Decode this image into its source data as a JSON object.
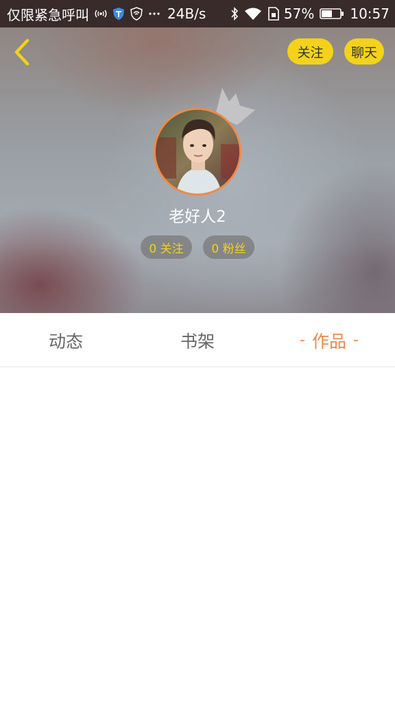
{
  "status_bar": {
    "carrier": "仅限紧急呼叫",
    "speed": "24B/s",
    "battery": "57%",
    "time": "10:57",
    "icons": [
      "signal-icon",
      "shield-icon",
      "vpn-icon",
      "more-icon",
      "bluetooth-icon",
      "wifi-icon",
      "sim-icon",
      "battery-icon"
    ]
  },
  "header": {
    "back_icon": "chevron-left-icon",
    "follow_label": "关注",
    "chat_label": "聊天",
    "username": "老好人2",
    "following_chip": "0 关注",
    "fans_chip": "0 粉丝"
  },
  "tabs": [
    {
      "label": "动态",
      "active": false
    },
    {
      "label": "书架",
      "active": false
    },
    {
      "label": "作品",
      "active": true
    }
  ],
  "colors": {
    "accent_yellow": "#f5d21a",
    "active_tab": "#f0884a",
    "avatar_border": "#f08a47"
  }
}
